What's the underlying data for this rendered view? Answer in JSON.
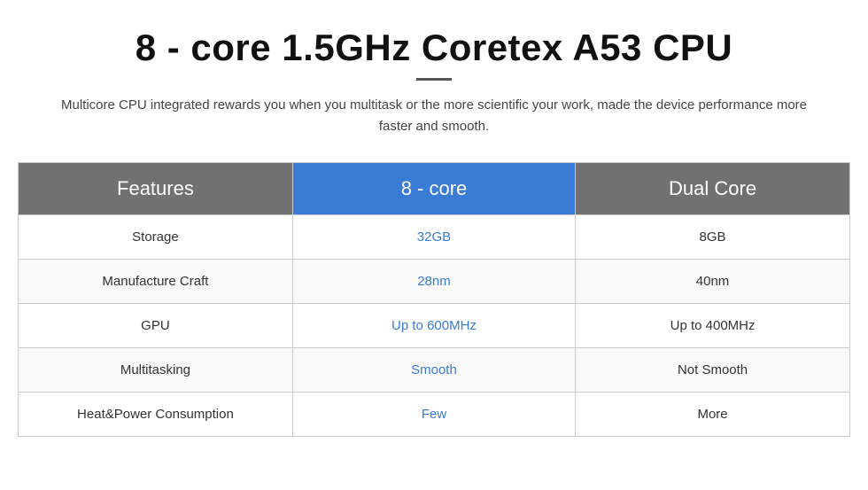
{
  "header": {
    "title": "8 - core 1.5GHz Coretex A53 CPU",
    "divider": true,
    "subtitle": "Multicore CPU integrated rewards you when you multitask or the more scientific your work, made the device performance more faster and smooth."
  },
  "table": {
    "columns": {
      "features": "Features",
      "col1": "8 - core",
      "col2": "Dual Core"
    },
    "rows": [
      {
        "feature": "Storage",
        "col1_value": "32GB",
        "col2_value": "8GB"
      },
      {
        "feature": "Manufacture Craft",
        "col1_value": "28nm",
        "col2_value": "40nm"
      },
      {
        "feature": "GPU",
        "col1_value": "Up to 600MHz",
        "col2_value": "Up to 400MHz"
      },
      {
        "feature": "Multitasking",
        "col1_value": "Smooth",
        "col2_value": "Not Smooth"
      },
      {
        "feature": "Heat&Power Consumption",
        "col1_value": "Few",
        "col2_value": "More"
      }
    ]
  }
}
